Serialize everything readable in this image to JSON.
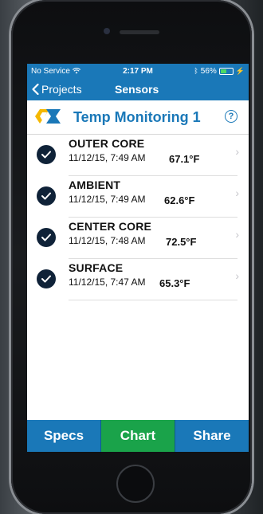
{
  "status_bar": {
    "carrier": "No Service",
    "time": "2:17 PM",
    "battery": "56%",
    "battery_level": 0.56
  },
  "nav": {
    "back_label": "Projects",
    "title": "Sensors"
  },
  "project": {
    "title": "Temp Monitoring 1",
    "help_label": "?"
  },
  "sensors": [
    {
      "name": "OUTER CORE",
      "time": "11/12/15, 7:49 AM",
      "temp": "67.1°F"
    },
    {
      "name": "AMBIENT",
      "time": "11/12/15, 7:49 AM",
      "temp": "62.6°F"
    },
    {
      "name": "CENTER CORE",
      "time": "11/12/15, 7:48 AM",
      "temp": "72.5°F"
    },
    {
      "name": "SURFACE",
      "time": "11/12/15, 7:47 AM",
      "temp": "65.3°F"
    }
  ],
  "tabs": [
    {
      "label": "Specs",
      "active": false
    },
    {
      "label": "Chart",
      "active": true
    },
    {
      "label": "Share",
      "active": false
    }
  ],
  "colors": {
    "primary": "#1a78b8",
    "active_tab": "#1aa34a",
    "check_bg": "#0f2238",
    "logo_yellow": "#f5b800",
    "logo_blue": "#1a78b8"
  }
}
